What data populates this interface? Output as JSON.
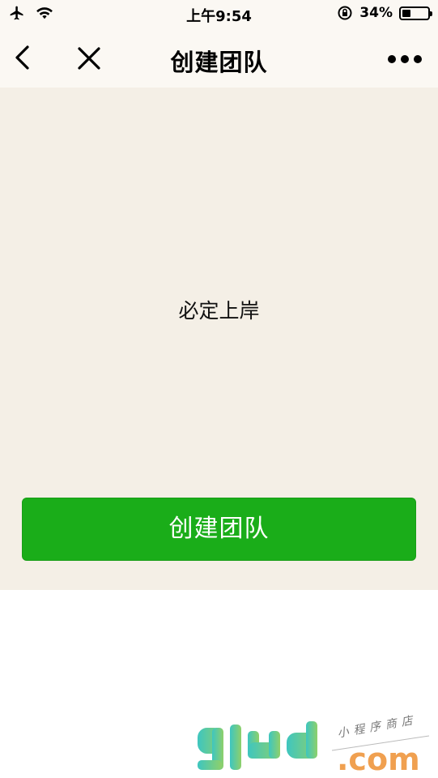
{
  "status_bar": {
    "time": "上午9:54",
    "battery_text": "34%",
    "battery_level": 0.34
  },
  "nav": {
    "title": "创建团队"
  },
  "main": {
    "team_name": "必定上岸",
    "create_button_label": "创建团队"
  },
  "watermark": {
    "logo": "glud",
    "tld": ".com",
    "tagline": "小程序商店"
  }
}
